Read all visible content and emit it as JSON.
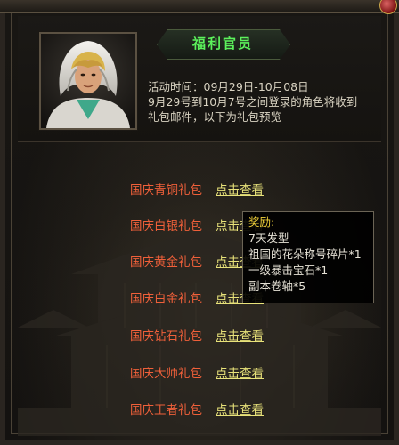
{
  "window": {
    "title": "福利官员"
  },
  "event": {
    "time_label": "活动时间：09月29日-10月08日",
    "desc_line1": "9月29号到10月7号之间登录的角色将收到",
    "desc_line2": "礼包邮件，以下为礼包预览"
  },
  "gifts": [
    {
      "name": "国庆青铜礼包",
      "action": "点击查看"
    },
    {
      "name": "国庆白银礼包",
      "action": "点击查看"
    },
    {
      "name": "国庆黄金礼包",
      "action": "点击查看"
    },
    {
      "name": "国庆白金礼包",
      "action": "点击查看"
    },
    {
      "name": "国庆钻石礼包",
      "action": "点击查看"
    },
    {
      "name": "国庆大师礼包",
      "action": "点击查看"
    },
    {
      "name": "国庆王者礼包",
      "action": "点击查看"
    }
  ],
  "tooltip": {
    "title": "奖励:",
    "items": [
      "7天发型",
      "祖国的花朵称号碎片*1",
      "一级暴击宝石*1",
      "副本卷轴*5"
    ]
  },
  "colors": {
    "title_green": "#5cf25c",
    "gift_name": "#f0603a",
    "link_yellow": "#e8e27a",
    "tooltip_title": "#f2d23a"
  },
  "icons": {
    "close": "close-icon",
    "portrait": "npc-portrait"
  }
}
